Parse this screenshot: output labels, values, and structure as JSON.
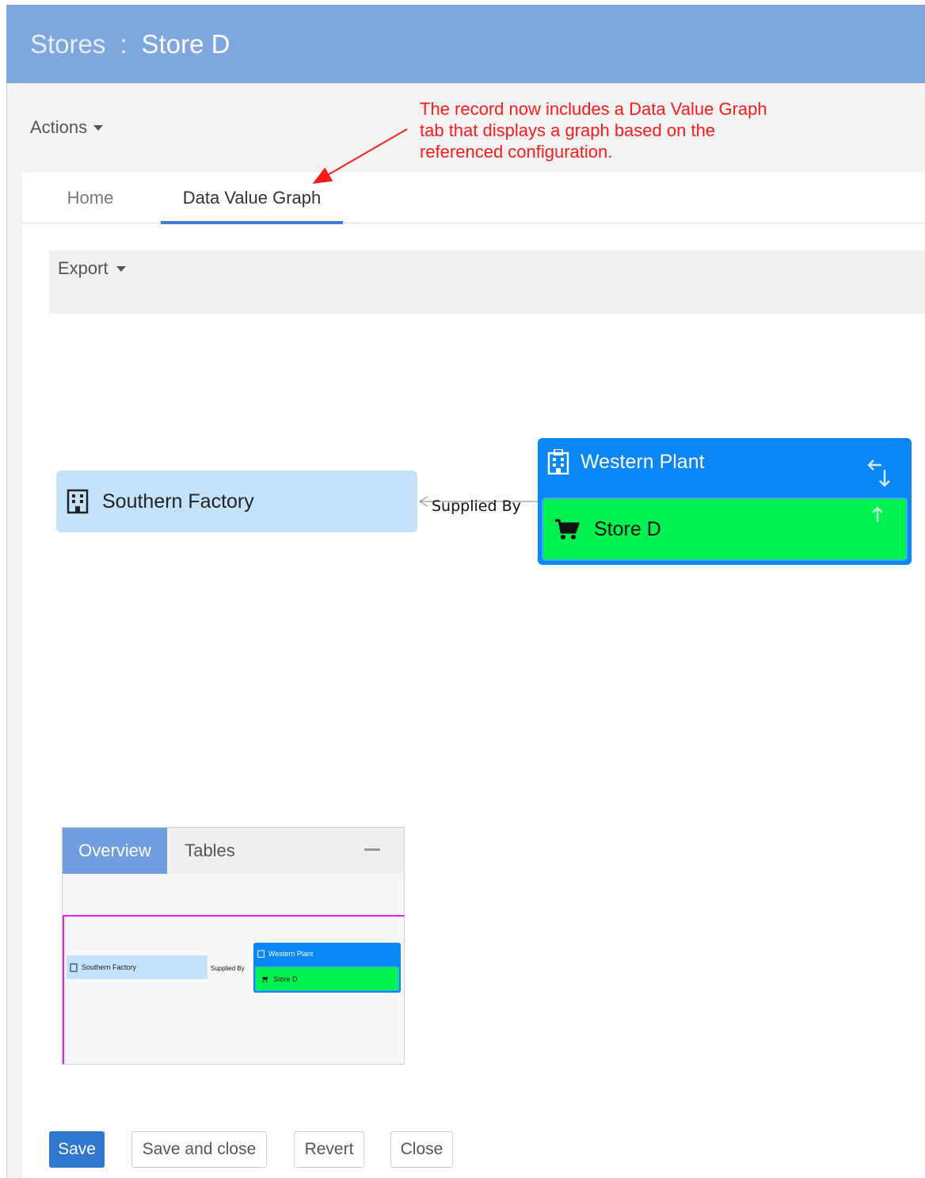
{
  "header": {
    "crumb": "Stores",
    "separator": ":",
    "title": "Store D"
  },
  "toolbar": {
    "actions_label": "Actions"
  },
  "callout": {
    "text": "The record now includes a Data Value Graph tab that displays a graph based on the referenced configuration.",
    "color": "#ff1a1a"
  },
  "tabs": [
    {
      "label": "Home",
      "active": false
    },
    {
      "label": "Data Value Graph",
      "active": true
    }
  ],
  "graph": {
    "export_label": "Export",
    "nodes": {
      "southern": {
        "label": "Southern Factory",
        "icon": "building-icon"
      },
      "western": {
        "label": "Western Plant",
        "icon": "hospital-building-icon"
      },
      "store": {
        "label": "Store D",
        "icon": "shopping-cart-icon"
      }
    },
    "edge_label": "Supplied By",
    "colors": {
      "southern_bg": "#c5e2fb",
      "western_bg": "#0a86f5",
      "store_bg": "#00f250"
    }
  },
  "minimap": {
    "tabs": [
      {
        "label": "Overview",
        "active": true
      },
      {
        "label": "Tables",
        "active": false
      }
    ]
  },
  "buttons": {
    "save": "Save",
    "save_close": "Save and close",
    "revert": "Revert",
    "close": "Close"
  }
}
